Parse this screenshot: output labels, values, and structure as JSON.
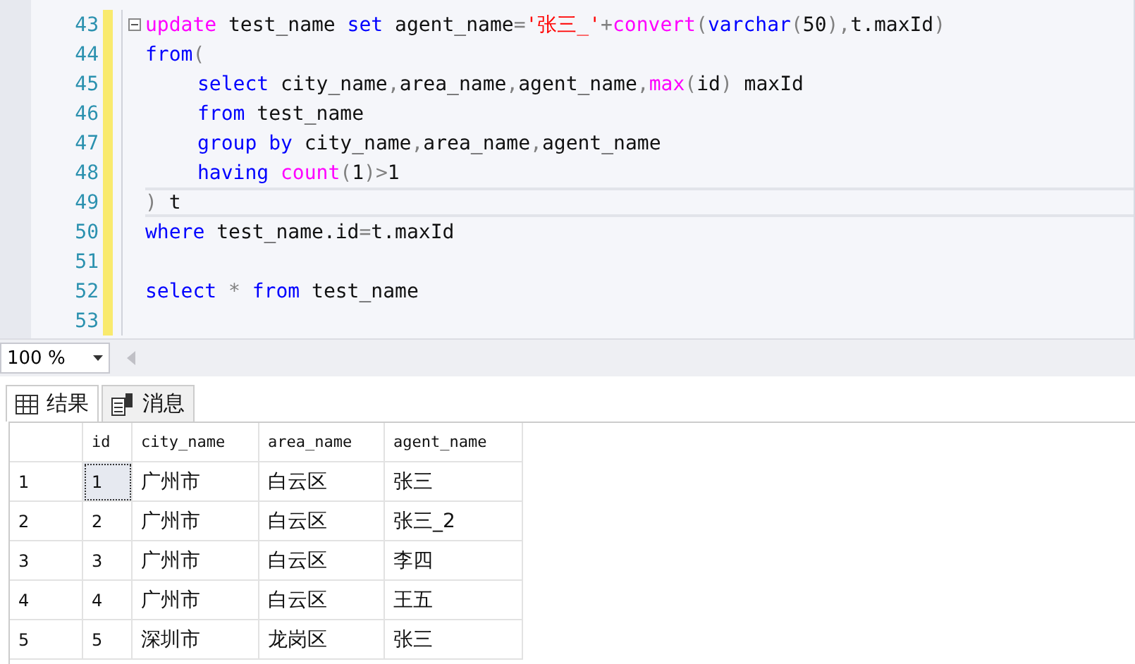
{
  "editor": {
    "lines": [
      {
        "number": "43",
        "indented": false,
        "fold": true,
        "changed": true,
        "current": false,
        "tokens": [
          {
            "kind": "func",
            "text": "update"
          },
          {
            "kind": "plain",
            "text": " test_name "
          },
          {
            "kind": "keyword",
            "text": "set"
          },
          {
            "kind": "plain",
            "text": " agent_name"
          },
          {
            "kind": "punct",
            "text": "="
          },
          {
            "kind": "string",
            "text": "'张三_'"
          },
          {
            "kind": "punct",
            "text": "+"
          },
          {
            "kind": "func",
            "text": "convert"
          },
          {
            "kind": "punct",
            "text": "("
          },
          {
            "kind": "keyword",
            "text": "varchar"
          },
          {
            "kind": "punct",
            "text": "("
          },
          {
            "kind": "plain",
            "text": "50"
          },
          {
            "kind": "punct",
            "text": "),"
          },
          {
            "kind": "plain",
            "text": "t.maxId"
          },
          {
            "kind": "punct",
            "text": ")"
          }
        ]
      },
      {
        "number": "44",
        "indented": false,
        "fold": false,
        "changed": true,
        "current": false,
        "tokens": [
          {
            "kind": "keyword",
            "text": "from"
          },
          {
            "kind": "punct",
            "text": "("
          }
        ]
      },
      {
        "number": "45",
        "indented": true,
        "fold": false,
        "changed": true,
        "current": false,
        "tokens": [
          {
            "kind": "keyword",
            "text": "select"
          },
          {
            "kind": "plain",
            "text": " city_name"
          },
          {
            "kind": "punct",
            "text": ","
          },
          {
            "kind": "plain",
            "text": "area_name"
          },
          {
            "kind": "punct",
            "text": ","
          },
          {
            "kind": "plain",
            "text": "agent_name"
          },
          {
            "kind": "punct",
            "text": ","
          },
          {
            "kind": "func",
            "text": "max"
          },
          {
            "kind": "punct",
            "text": "("
          },
          {
            "kind": "plain",
            "text": "id"
          },
          {
            "kind": "punct",
            "text": ")"
          },
          {
            "kind": "plain",
            "text": " maxId"
          }
        ]
      },
      {
        "number": "46",
        "indented": true,
        "fold": false,
        "changed": true,
        "current": false,
        "tokens": [
          {
            "kind": "keyword",
            "text": "from"
          },
          {
            "kind": "plain",
            "text": " test_name"
          }
        ]
      },
      {
        "number": "47",
        "indented": true,
        "fold": false,
        "changed": true,
        "current": false,
        "tokens": [
          {
            "kind": "keyword",
            "text": "group by"
          },
          {
            "kind": "plain",
            "text": " city_name"
          },
          {
            "kind": "punct",
            "text": ","
          },
          {
            "kind": "plain",
            "text": "area_name"
          },
          {
            "kind": "punct",
            "text": ","
          },
          {
            "kind": "plain",
            "text": "agent_name"
          }
        ]
      },
      {
        "number": "48",
        "indented": true,
        "fold": false,
        "changed": true,
        "current": false,
        "tokens": [
          {
            "kind": "keyword",
            "text": "having"
          },
          {
            "kind": "func",
            "text": " count"
          },
          {
            "kind": "punct",
            "text": "("
          },
          {
            "kind": "plain",
            "text": "1"
          },
          {
            "kind": "punct",
            "text": ")>"
          },
          {
            "kind": "plain",
            "text": "1"
          }
        ]
      },
      {
        "number": "49",
        "indented": false,
        "fold": false,
        "changed": true,
        "current": true,
        "tokens": [
          {
            "kind": "punct",
            "text": ")"
          },
          {
            "kind": "plain",
            "text": " t"
          }
        ]
      },
      {
        "number": "50",
        "indented": false,
        "fold": false,
        "changed": true,
        "current": false,
        "tokens": [
          {
            "kind": "keyword",
            "text": "where"
          },
          {
            "kind": "plain",
            "text": " test_name.id"
          },
          {
            "kind": "punct",
            "text": "="
          },
          {
            "kind": "plain",
            "text": "t.maxId"
          }
        ]
      },
      {
        "number": "51",
        "indented": false,
        "fold": false,
        "changed": true,
        "current": false
      },
      {
        "number": "52",
        "indented": false,
        "fold": false,
        "changed": true,
        "current": false,
        "tokens": [
          {
            "kind": "keyword",
            "text": "select"
          },
          {
            "kind": "punct",
            "text": " * "
          },
          {
            "kind": "keyword",
            "text": "from"
          },
          {
            "kind": "plain",
            "text": " test_name"
          }
        ]
      },
      {
        "number": "53",
        "indented": false,
        "fold": false,
        "changed": true,
        "current": false
      }
    ]
  },
  "zoom": {
    "value": "100 %"
  },
  "tabs": [
    {
      "label": "结果",
      "kind": "grid",
      "selected": true
    },
    {
      "label": "消息",
      "kind": "messages",
      "selected": false
    }
  ],
  "table": {
    "columns": [
      "id",
      "city_name",
      "area_name",
      "agent_name"
    ],
    "rows": [
      {
        "number": "1",
        "selected": true,
        "cells": [
          "1",
          "广州市",
          "白云区",
          "张三"
        ]
      },
      {
        "number": "2",
        "selected": false,
        "cells": [
          "2",
          "广州市",
          "白云区",
          "张三_2"
        ]
      },
      {
        "number": "3",
        "selected": false,
        "cells": [
          "3",
          "广州市",
          "白云区",
          "李四"
        ]
      },
      {
        "number": "4",
        "selected": false,
        "cells": [
          "4",
          "广州市",
          "白云区",
          "王五"
        ]
      },
      {
        "number": "5",
        "selected": false,
        "cells": [
          "5",
          "深圳市",
          "龙岗区",
          "张三"
        ]
      }
    ]
  }
}
